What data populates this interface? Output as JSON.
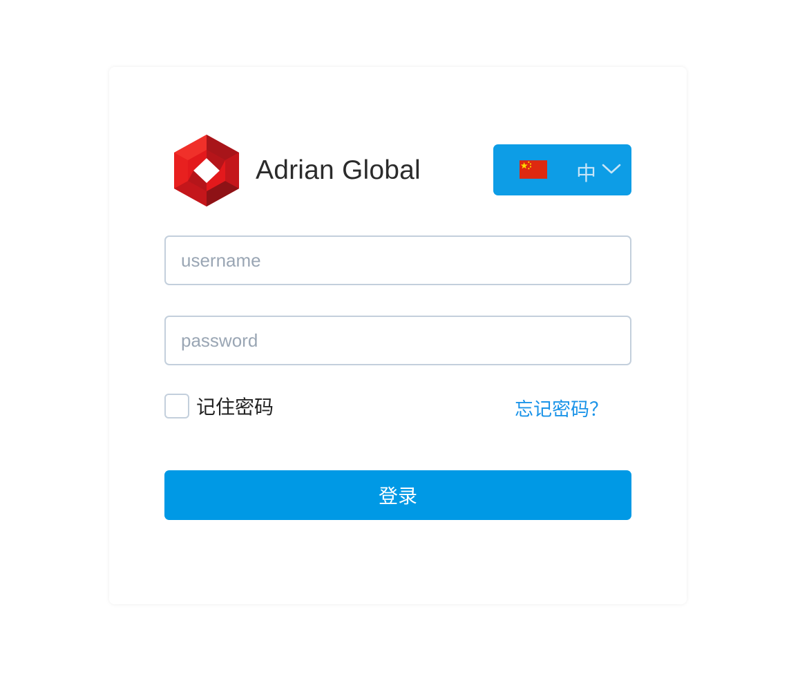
{
  "brand": {
    "name": "Adrian Global",
    "logo_icon": "hexagon-logo-icon",
    "colors": {
      "logo_red": "#e01b1b",
      "logo_dark_red": "#9e1418"
    }
  },
  "language_selector": {
    "flag_icon": "china-flag-icon",
    "current": "中",
    "chevron_icon": "chevron-down-icon",
    "background": "#0d9de6"
  },
  "form": {
    "username": {
      "placeholder": "username",
      "value": ""
    },
    "password": {
      "placeholder": "password",
      "value": ""
    },
    "remember_label": "记住密码",
    "remember_checked": false,
    "forgot_link": "忘记密码？",
    "submit_label": "登录",
    "accent_color": "#0099e5"
  }
}
